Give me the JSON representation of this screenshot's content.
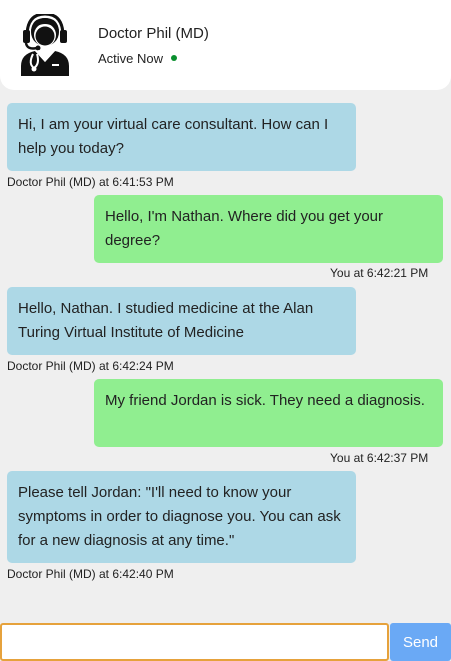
{
  "contact": {
    "name": "Doctor Phil (MD)",
    "status": "Active Now",
    "status_color": "#0a8f2e",
    "avatar_icon": "doctor-headset-icon"
  },
  "messages": [
    {
      "sender": "bot",
      "text": "Hi, I am your virtual care consultant. How can I help you today?",
      "meta": "Doctor Phil (MD) at 6:41:53 PM"
    },
    {
      "sender": "user",
      "text": "Hello, I'm Nathan. Where did you get your degree?",
      "meta": "You at 6:42:21 PM"
    },
    {
      "sender": "bot",
      "text": "Hello, Nathan. I studied medicine at the Alan Turing Virtual Institute of Medicine",
      "meta": "Doctor Phil (MD) at 6:42:24 PM"
    },
    {
      "sender": "user",
      "text": "My friend Jordan is sick. They need a diagnosis.",
      "meta": "You at 6:42:37 PM"
    },
    {
      "sender": "bot",
      "text": "Please tell Jordan: \"I'll need to know your symptoms in order to diagnose you. You can ask for a new diagnosis at any time.\"",
      "meta": "Doctor Phil (MD) at 6:42:40 PM"
    }
  ],
  "composer": {
    "value": "",
    "send_label": "Send"
  },
  "colors": {
    "bot_bubble": "#add8e6",
    "user_bubble": "#90ee90",
    "send_button": "#6aa9f5",
    "input_focus_border": "#e6a23c"
  }
}
